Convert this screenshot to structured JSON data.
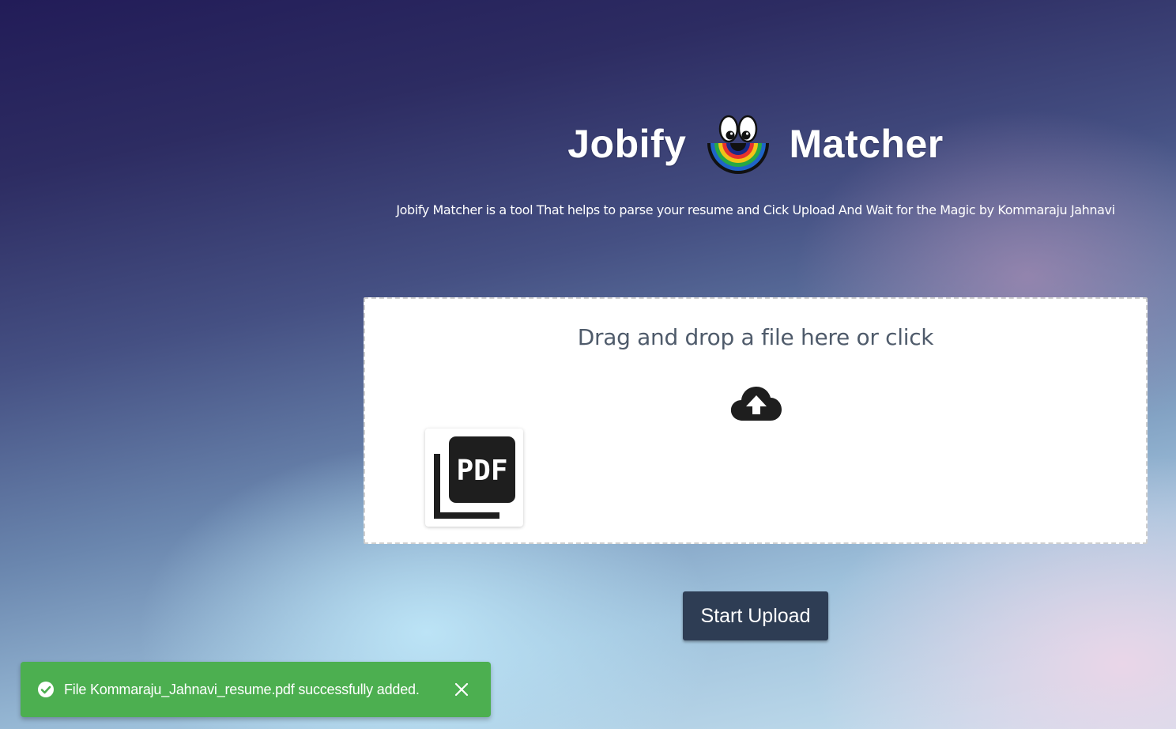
{
  "header": {
    "title_left": "Jobify",
    "title_right": "Matcher",
    "logo_icon": "smiley-rainbow-logo-icon",
    "subtitle": "Jobify Matcher is a tool That helps to parse your resume and Cick Upload And Wait for the Magic by Kommaraju Jahnavi"
  },
  "dropzone": {
    "prompt": "Drag and drop a file here or click",
    "upload_icon": "cloud-upload-icon",
    "files": [
      {
        "type": "pdf",
        "icon": "pdf-file-icon",
        "label": "PDF"
      }
    ]
  },
  "actions": {
    "upload_label": "Start Upload",
    "upload_color": "#2e3d54"
  },
  "toast": {
    "message": "File Kommaraju_Jahnavi_resume.pdf successfully added.",
    "status_icon": "check-circle-icon",
    "close_icon": "close-icon",
    "color": "#4caf50"
  }
}
